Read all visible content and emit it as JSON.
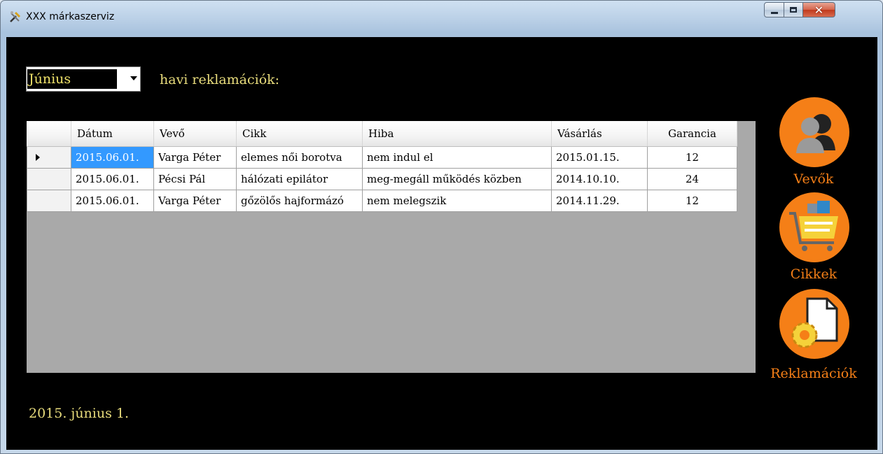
{
  "window": {
    "title": "XXX márkaszerviz"
  },
  "header": {
    "month_selected": "Június",
    "label": "havi reklamációk:"
  },
  "table": {
    "columns": [
      "Dátum",
      "Vevő",
      "Cikk",
      "Hiba",
      "Vásárlás",
      "Garancia"
    ],
    "rows": [
      [
        "2015.06.01.",
        "Varga Péter",
        "elemes női borotva",
        "nem indul el",
        "2015.01.15.",
        "12"
      ],
      [
        "2015.06.01.",
        "Pécsi Pál",
        "hálózati epilátor",
        "meg-megáll működés közben",
        "2014.10.10.",
        "24"
      ],
      [
        "2015.06.01.",
        "Varga Péter",
        "gőzölős hajformázó",
        "nem melegszik",
        "2014.11.29.",
        "12"
      ]
    ]
  },
  "nav": {
    "customers": "Vevők",
    "products": "Cikkek",
    "complaints": "Reklamációk"
  },
  "footer": {
    "date": "2015. június 1."
  },
  "colors": {
    "accent": "#f57f17",
    "text_yellow": "#e8dc7c",
    "background": "#000000",
    "selection": "#3399ff"
  }
}
